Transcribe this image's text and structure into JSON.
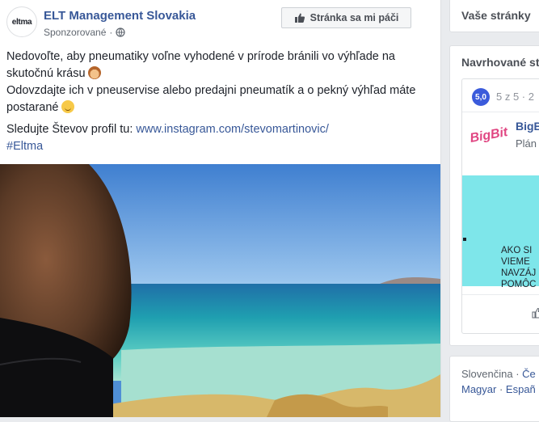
{
  "post": {
    "page_name": "ELT Management Slovakia",
    "avatar_text": "eltma",
    "sponsored": "Sponzorované",
    "sponsored_sep": "·",
    "like_page_button": "Stránka sa mi páči",
    "text_line1": "Nedovoľte, aby pneumatiky voľne vyhodené v prírode bránili vo výhľade na skutočnú krásu",
    "text_line2": "Odovzdajte ich v pneuservise alebo predajni pneumatík a o pekný výhľad máte postarané",
    "follow_prefix": "Sledujte Števov profil tu: ",
    "follow_link": "www.instagram.com/stevomartinovic/",
    "hashtag": "#Eltma",
    "icons": [
      "globe-icon",
      "thumbs-up-icon"
    ]
  },
  "sidebar": {
    "your_pages_title": "Vaše stránky",
    "suggested_title": "Navrhované st",
    "rating_value": "5,0",
    "rating_text": "5 z 5 · 2",
    "suggested_page_logo": "BigBit",
    "suggested_page_name": "BigB",
    "suggested_page_category": "Plán",
    "ad_text_line1": "AKO SI",
    "ad_text_line2": "VIEME",
    "ad_text_line3": "NAVZÁJ",
    "ad_text_line4": "POMÔC",
    "lang_current": "Slovenčina",
    "lang_sep1": " · ",
    "lang_czech": "Če",
    "lang_hungarian": "Magyar",
    "lang_sep2": " · ",
    "lang_spanish": "Españ"
  },
  "colors": {
    "link": "#385898",
    "ad_background": "#7ee6ea",
    "rating_badge": "#3b5bdb"
  }
}
